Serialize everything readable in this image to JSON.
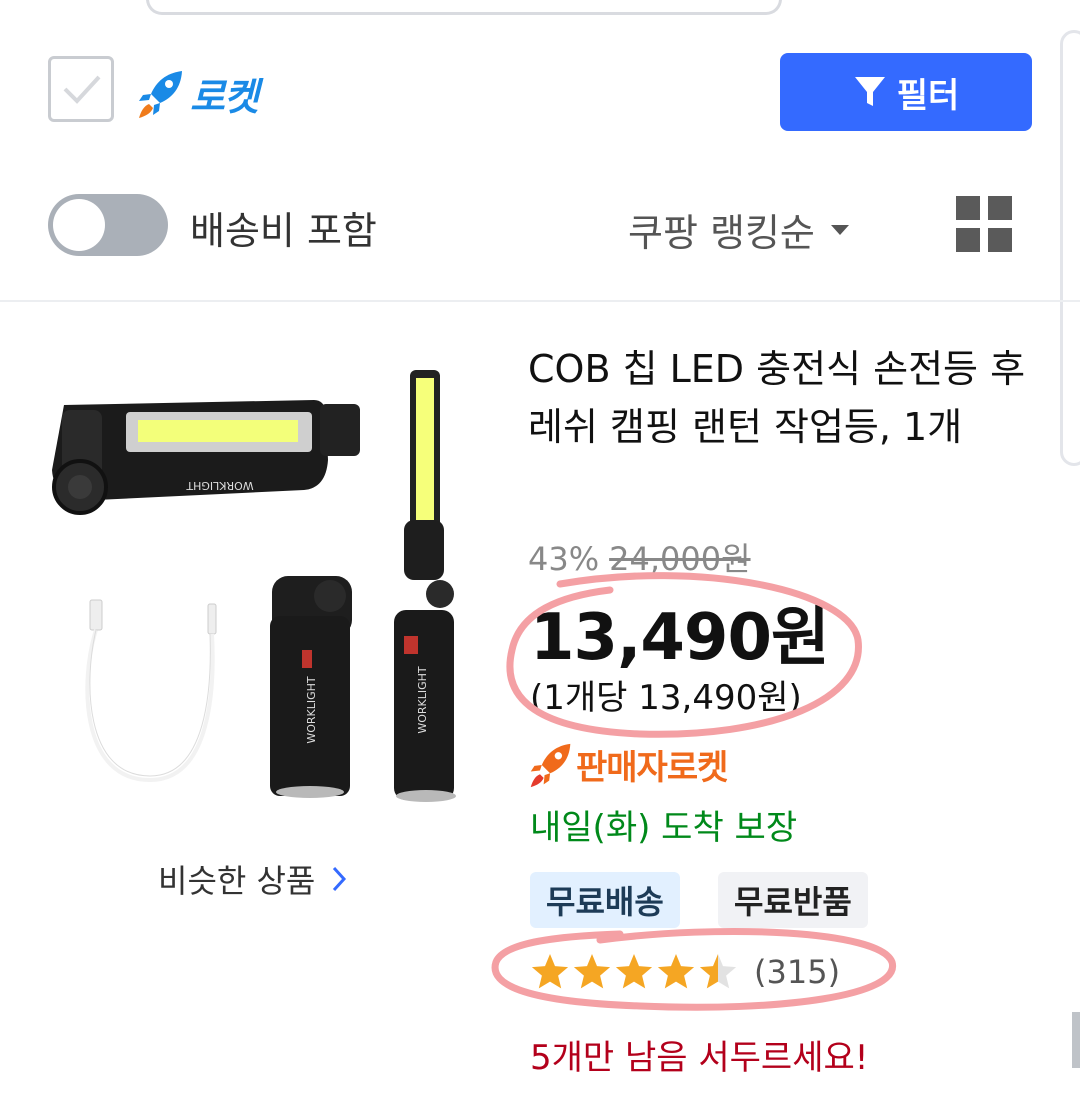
{
  "header": {
    "rocket_filter_label": "로켓",
    "filter_button_label": "필터",
    "shipping_toggle_label": "배송비 포함",
    "shipping_toggle_on": false,
    "sort_label": "쿠팡 랭킹순"
  },
  "product": {
    "title": "COB 칩 LED 충전식 손전등 후레쉬 캠핑 랜턴 작업등, 1개",
    "image_labels": [
      "WORKLIGHT",
      "WORKLIGHT",
      "WORKLIGHT"
    ],
    "discount_rate": "43%",
    "original_price": "24,000원",
    "price": "13,490원",
    "unit_price": "(1개당 13,490원)",
    "seller_badge": "판매자로켓",
    "delivery": "내일(화) 도착 보장",
    "badges": [
      "무료배송",
      "무료반품"
    ],
    "rating": 4.5,
    "rating_max": 5,
    "review_count": "(315)",
    "stock_notice": "5개만 남음 서두르세요!",
    "similar_link": "비슷한 상품"
  },
  "colors": {
    "accent_blue": "#346aff",
    "rocket_blue": "#1a8ae6",
    "seller_rocket_orange": "#f06a1b",
    "delivery_green": "#00891a",
    "stock_red": "#b3001b",
    "star": "#f5a623",
    "annotation_pink": "#f4a0a4"
  }
}
